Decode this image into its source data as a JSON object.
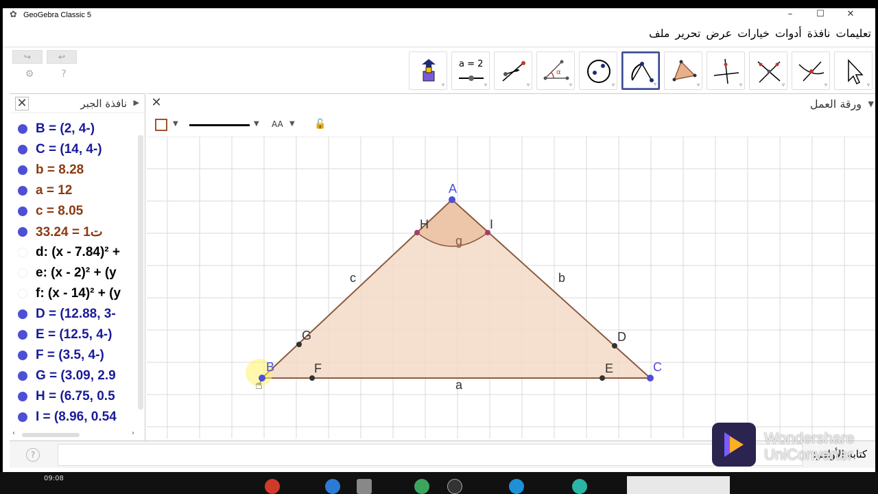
{
  "window": {
    "title": "GeoGebra Classic 5",
    "controls": [
      "–",
      "☐",
      "✕"
    ]
  },
  "menubar": [
    "ملف",
    "تحرير",
    "عرض",
    "خيارات",
    "أدوات",
    "نافذة",
    "تعليمات"
  ],
  "toolbar": {
    "tools": [
      {
        "name": "move",
        "icon": "cursor-arrow-icon"
      },
      {
        "name": "point",
        "icon": "intersect-point-icon"
      },
      {
        "name": "line",
        "icon": "line-through-points-icon"
      },
      {
        "name": "perpendicular",
        "icon": "perpendicular-line-icon"
      },
      {
        "name": "polygon",
        "icon": "polygon-icon"
      },
      {
        "name": "circle-arc",
        "icon": "circle-arc-icon",
        "selected": true
      },
      {
        "name": "circle",
        "icon": "circle-icon"
      },
      {
        "name": "angle",
        "icon": "angle-icon"
      },
      {
        "name": "reflect",
        "icon": "reflect-icon"
      },
      {
        "name": "slider",
        "icon": "slider-icon",
        "label": "a = 2"
      },
      {
        "name": "move-graphics",
        "icon": "move-graphics-icon"
      }
    ]
  },
  "algebra": {
    "title": "نافذة الجبر",
    "items": [
      {
        "text": "B = (2, 4-)",
        "color": "#1a1a9a",
        "dot": "on"
      },
      {
        "text": "C = (14, 4-)",
        "color": "#1a1a9a",
        "dot": "on"
      },
      {
        "text": "b = 8.28",
        "color": "#8b3a10",
        "dot": "on"
      },
      {
        "text": "a = 12",
        "color": "#8b3a10",
        "dot": "on"
      },
      {
        "text": "c = 8.05",
        "color": "#8b3a10",
        "dot": "on"
      },
      {
        "text": "ت1 = 33.24",
        "color": "#8b3a10",
        "dot": "on"
      },
      {
        "text": "d: (x - 7.84)² +",
        "color": "#000000",
        "dot": "off"
      },
      {
        "text": "e: (x - 2)² + (y",
        "color": "#000000",
        "dot": "off"
      },
      {
        "text": "f: (x - 14)² + (y",
        "color": "#000000",
        "dot": "off"
      },
      {
        "text": "D = (12.88, 3-",
        "color": "#1a1a9a",
        "dot": "on"
      },
      {
        "text": "E = (12.5, 4-)",
        "color": "#1a1a9a",
        "dot": "on"
      },
      {
        "text": "F = (3.5, 4-)",
        "color": "#1a1a9a",
        "dot": "on"
      },
      {
        "text": "G = (3.09, 2.9",
        "color": "#1a1a9a",
        "dot": "on"
      },
      {
        "text": "H = (6.75, 0.5",
        "color": "#1a1a9a",
        "dot": "on"
      },
      {
        "text": "I = (8.96, 0.54",
        "color": "#1a1a9a",
        "dot": "on"
      }
    ]
  },
  "graphics": {
    "title": "ورقة العمل",
    "stylebar": {
      "font_label": "AA"
    },
    "labels": {
      "A": "A",
      "B": "B",
      "C": "C",
      "D": "D",
      "E": "E",
      "F": "F",
      "G": "G",
      "H": "H",
      "I": "I",
      "a": "a",
      "b": "b",
      "c": "c",
      "g": "g"
    },
    "colors": {
      "triangle_fill": "#f3d9c6",
      "triangle_edge": "#8a5a40",
      "free_point": "#4d4fd6",
      "dependent_point": "#333333",
      "grid": "#d8d8d8"
    }
  },
  "inputbar": {
    "label": "كتابة الأوامر:",
    "help": "?"
  },
  "watermark": {
    "line1": "Wondershare",
    "line2": "UniConverter"
  },
  "taskbar": {
    "clock": "09:08"
  }
}
